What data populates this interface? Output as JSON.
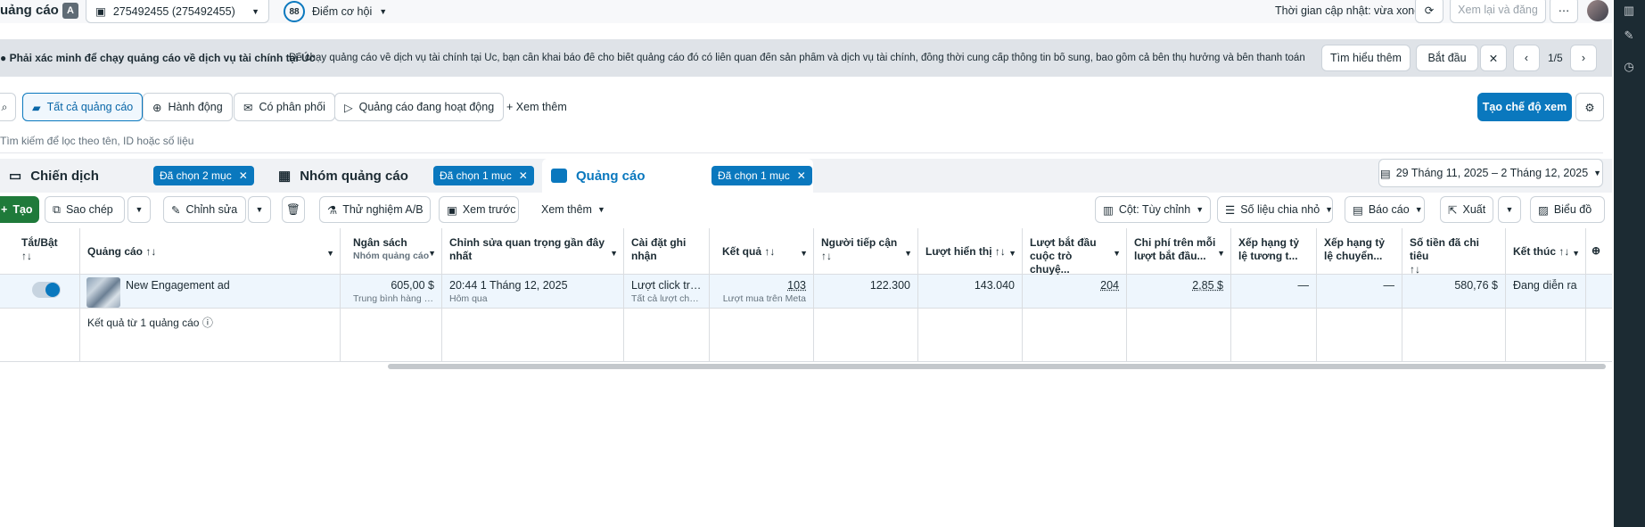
{
  "header": {
    "title": "uảng cáo",
    "account_initial": "A",
    "account_name": "275492455 (275492455)",
    "opportunity_score": "88",
    "opportunity_label": "Điểm cơ hội",
    "update_time": "Thời gian cập nhật: vừa xong",
    "review_publish": "Xem lại và đăng"
  },
  "banner": {
    "title": "Phải xác minh để chạy quảng cáo về dịch vụ tài chính tại Úc",
    "text": "Để chạy quảng cáo về dịch vụ tài chính tại Úc, bạn cần khai báo để cho biết quảng cáo đó có liên quan đến sản phẩm và dịch vụ tài chính, đồng thời cung cấp thông tin bổ sung, bao gồm cả bên thụ hưởng và bên thanh toán đã x...",
    "learn_more": "Tìm hiểu thêm",
    "start": "Bắt đầu",
    "pager": "1/5"
  },
  "filters": {
    "chips": [
      "Tất cả quảng cáo",
      "Hành động",
      "Có phân phối",
      "Quảng cáo đang hoạt động"
    ],
    "more": "Xem thêm",
    "create_view": "Tạo chế độ xem",
    "search_placeholder": "Tìm kiếm để lọc theo tên, ID hoặc số liệu"
  },
  "tabs": {
    "campaign": "Chiến dịch",
    "campaign_sel": "Đã chọn 2 mục",
    "adset": "Nhóm quảng cáo",
    "adset_sel": "Đã chọn 1 mục",
    "ad": "Quảng cáo",
    "ad_sel": "Đã chọn 1 mục",
    "date_range": "29 Tháng 11, 2025 – 2 Tháng 12, 2025"
  },
  "toolbar": {
    "create": "Tạo",
    "copy": "Sao chép",
    "edit": "Chỉnh sửa",
    "ab_test": "Thử nghiệm A/B",
    "preview": "Xem trước",
    "more": "Xem thêm",
    "columns": "Cột: Tùy chỉnh",
    "breakdown": "Số liệu chia nhỏ",
    "reports": "Báo cáo",
    "export": "Xuất",
    "chart": "Biểu đồ"
  },
  "table": {
    "headers": {
      "onoff": "Tắt/Bật",
      "ad": "Quảng cáo",
      "budget": "Ngân sách",
      "budget_sub": "Nhóm quảng cáo",
      "last_edit": "Chỉnh sửa quan trọng gần đây nhất",
      "attribution": "Cài đặt ghi nhận",
      "results": "Kết quả",
      "reach": "Người tiếp cận",
      "impressions": "Lượt hiển thị",
      "conv_start": "Lượt bắt đầu cuộc trò chuyệ...",
      "cost_conv": "Chi phí trên mỗi lượt bắt đầu...",
      "rank1": "Xếp hạng tỷ lệ tương t...",
      "rank2": "Xếp hạng tỷ lệ chuyển...",
      "spent": "Số tiền đã chi tiêu",
      "end": "Kết thúc"
    },
    "row": {
      "name": "New Engagement ad",
      "budget": "605,00 $",
      "budget_sub": "Trung bình hàng ng...",
      "last_edit": "20:44 1 Tháng 12, 2025",
      "last_edit_sub": "Hôm qua",
      "attribution": "Lượt click tro...",
      "attribution_sub": "Tất cả lượt chuyể...",
      "results": "103",
      "results_sub": "Lượt mua trên Meta",
      "reach": "122.300",
      "impressions": "143.040",
      "conv_start": "204",
      "cost_conv": "2,85 $",
      "rank1": "—",
      "rank2": "—",
      "spent": "580,76 $",
      "end": "Đang diễn ra"
    },
    "footer": "Kết quả từ 1 quảng cáo"
  }
}
